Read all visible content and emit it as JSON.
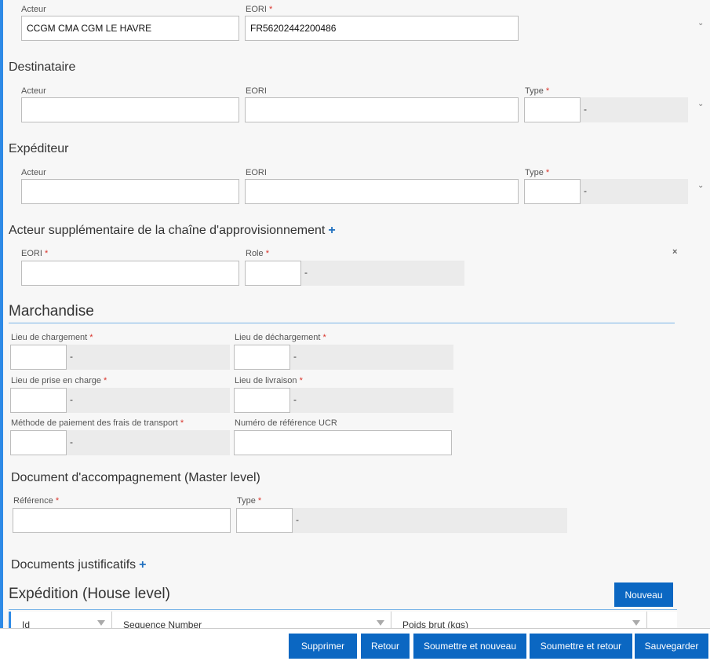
{
  "transporteur": {
    "acteur_label": "Acteur",
    "acteur_value": "CCGM CMA CGM LE HAVRE",
    "eori_label": "EORI",
    "eori_value": "FR56202442200486"
  },
  "destinataire": {
    "title": "Destinataire",
    "acteur_label": "Acteur",
    "eori_label": "EORI",
    "type_label": "Type",
    "type_desc": "-"
  },
  "expediteur": {
    "title": "Expéditeur",
    "acteur_label": "Acteur",
    "eori_label": "EORI",
    "type_label": "Type",
    "type_desc": "-"
  },
  "acteur_supp": {
    "title": "Acteur supplémentaire de la chaîne d'approvisionnement",
    "plus": "+",
    "eori_label": "EORI",
    "role_label": "Role",
    "role_desc": "-",
    "remove": "×"
  },
  "marchandise": {
    "title": "Marchandise",
    "lieu_chargement_label": "Lieu de chargement",
    "lieu_chargement_desc": "-",
    "lieu_dechargement_label": "Lieu de déchargement",
    "lieu_dechargement_desc": "-",
    "lieu_prise_label": "Lieu de prise en charge",
    "lieu_prise_desc": "-",
    "lieu_livraison_label": "Lieu de livraison",
    "lieu_livraison_desc": "-",
    "methode_paiement_label": "Méthode de paiement des frais de transport",
    "methode_paiement_desc": "-",
    "ucr_label": "Numéro de référence UCR"
  },
  "document_accomp": {
    "title": "Document d'accompagnement (Master level)",
    "reference_label": "Référence",
    "type_label": "Type",
    "type_desc": "-"
  },
  "documents_justificatifs": {
    "title": "Documents justificatifs",
    "plus": "+"
  },
  "expedition": {
    "title": "Expédition (House level)",
    "new_button": "Nouveau",
    "columns": [
      "Id",
      "Sequence Number",
      "Poids brut (kgs)"
    ]
  },
  "footer": {
    "delete": "Supprimer",
    "back": "Retour",
    "submit_new": "Soumettre et nouveau",
    "submit_back": "Soumettre et retour",
    "save": "Sauvegarder"
  },
  "required_marker": "*",
  "colors": {
    "accent": "#0b67c2",
    "left_bar": "#2e8ae6",
    "required": "#d9342b"
  }
}
